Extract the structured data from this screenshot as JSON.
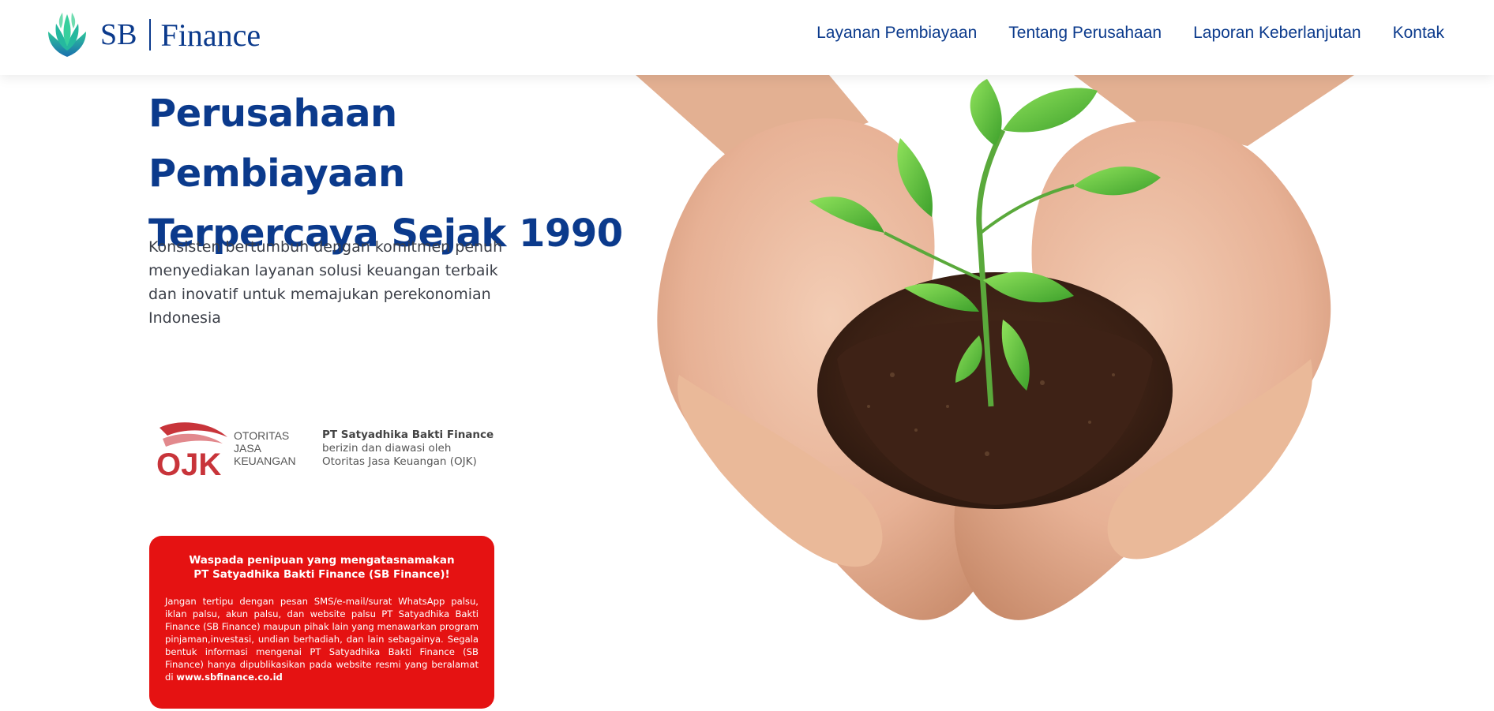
{
  "header": {
    "logo": {
      "brand_short": "SB",
      "brand_name": "Finance"
    },
    "nav": [
      {
        "label": "Layanan Pembiayaan"
      },
      {
        "label": "Tentang Perusahaan"
      },
      {
        "label": "Laporan Keberlanjutan"
      },
      {
        "label": "Kontak"
      }
    ]
  },
  "hero": {
    "title_line1": "Perusahaan Pembiayaan",
    "title_line2": "Terpercaya Sejak 1990",
    "subtitle": "Konsisten bertumbuh dengan komitmen penuh menyediakan layanan solusi keuangan terbaik dan inovatif untuk memajukan perekonomian Indonesia",
    "image_icon": "hands-holding-plant-image"
  },
  "ojk": {
    "logo_text": "OJK",
    "words": [
      "OTORITAS",
      "JASA",
      "KEUANGAN"
    ],
    "company": "PT Satyadhika Bakti Finance",
    "line2": "berizin dan diawasi oleh",
    "line3": "Otoritas Jasa Keuangan (OJK)"
  },
  "warning": {
    "title_line1": "Waspada penipuan yang mengatasnamakan",
    "title_line2": "PT Satyadhika Bakti Finance (SB Finance)!",
    "body": "Jangan tertipu dengan pesan SMS/e-mail/surat WhatsApp palsu, iklan palsu, akun palsu, dan website palsu PT Satyadhika Bakti Finance (SB Finance) maupun pihak lain yang menawarkan program pinjaman,investasi, undian berhadiah, dan lain sebagainya. Segala bentuk informasi mengenai PT Satyadhika Bakti Finance (SB Finance) hanya dipublikasikan pada website resmi yang beralamat di ",
    "url": "www.sbfinance.co.id"
  },
  "colors": {
    "brand_blue": "#0b3a8c",
    "warning_red": "#e51212",
    "leaf_teal": "#1aa89a"
  }
}
